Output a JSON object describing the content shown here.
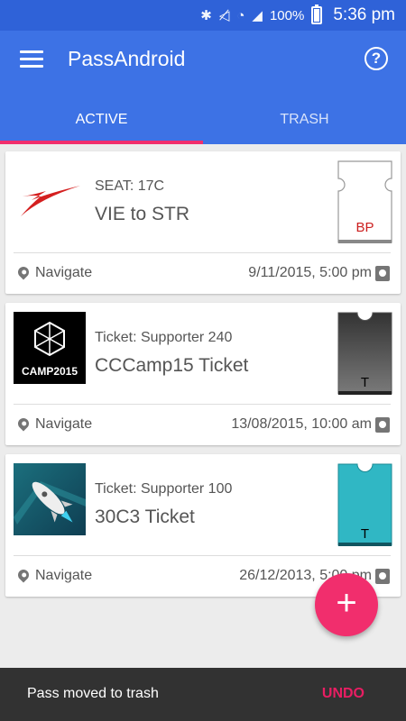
{
  "status_bar": {
    "battery": "100%",
    "time": "5:36 pm"
  },
  "app_bar": {
    "title": "PassAndroid"
  },
  "tabs": [
    {
      "label": "ACTIVE",
      "active": true
    },
    {
      "label": "TRASH",
      "active": false
    }
  ],
  "passes": [
    {
      "subtitle": "SEAT: 17C",
      "title": "VIE to STR",
      "navigate": "Navigate",
      "date": "9/11/2015, 5:00 pm",
      "pass_label": "BP",
      "pass_color": "#ffffff",
      "accent": "#cc1f1f"
    },
    {
      "subtitle": "Ticket: Supporter 240",
      "title": "CCCamp15 Ticket",
      "navigate": "Navigate",
      "date": "13/08/2015, 10:00 am",
      "pass_label": "T",
      "pass_color": "#5a5a5a",
      "thumb_text": "CAMP2015"
    },
    {
      "subtitle": "Ticket: Supporter 100",
      "title": "30C3 Ticket",
      "navigate": "Navigate",
      "date": "26/12/2013, 5:00 pm",
      "pass_label": "T",
      "pass_color": "#30b7c4"
    }
  ],
  "snackbar": {
    "message": "Pass moved to trash",
    "action": "UNDO"
  },
  "colors": {
    "primary": "#3d72e5",
    "status": "#2f62d8",
    "accent": "#f12e6d"
  }
}
